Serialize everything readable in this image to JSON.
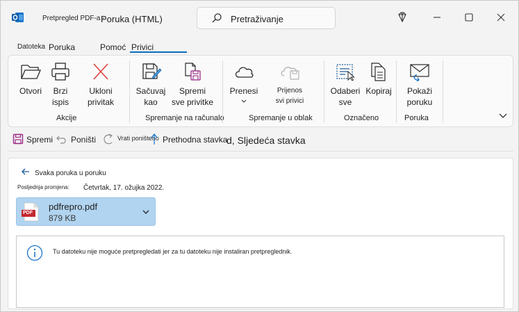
{
  "titlebar": {
    "app_icon": "outlook-icon",
    "title_small": "Pretpregled PDF-a -",
    "title_main": "Poruka (HTML)",
    "search_placeholder": "Pretraživanje"
  },
  "menu_tabs": [
    {
      "label": "Datoteka"
    },
    {
      "label": "Poruka"
    },
    {
      "label": "Pomoć"
    },
    {
      "label": "Privici",
      "active": true
    }
  ],
  "ribbon": {
    "actions": {
      "open": "Otvori",
      "quick_print": [
        "Brzi",
        "ispis"
      ],
      "remove_attachment": [
        "Ukloni",
        "privitak"
      ],
      "group": "Akcije"
    },
    "save_to_computer": {
      "save_as": [
        "Sačuvaj",
        "kao"
      ],
      "save_all": [
        "Spremi",
        "sve privitke"
      ],
      "group": "Spremanje na računalo"
    },
    "save_to_cloud": {
      "upload": "Prenesi",
      "transfer_all": [
        "Prijenos",
        "svi privici"
      ],
      "group": "Spremanje u oblak"
    },
    "selection": {
      "select_all": [
        "Odaberi",
        "sve"
      ],
      "copy": "Kopiraj",
      "group": "Označeno"
    },
    "message": {
      "show_message": [
        "Pokaži",
        "poruku"
      ],
      "group": "Poruka"
    }
  },
  "quick_toolbar": {
    "save": "Spremi",
    "undo": "Poništi",
    "redo": "Vrati poništeno",
    "previous": "Prethodna stavka",
    "next": "d, Sljedeća stavka"
  },
  "content": {
    "back_link": "Svaka poruka u poruku",
    "modified_label": "Posljednja promjena:",
    "modified_value": "Četvrtak, 17. ožujka 2022.",
    "attachment": {
      "name": "pdfrepro.pdf",
      "size": "879 KB",
      "badge": "PDF"
    },
    "info_message": "Tu datoteku nije moguće pretpregledati jer za tu datoteku nije instaliran pretpreglednik."
  },
  "colors": {
    "accent": "#0f6cbd",
    "attachment_bg": "#b1d4f0",
    "remove_red": "#e0413c",
    "save_purple": "#9b2c86"
  }
}
